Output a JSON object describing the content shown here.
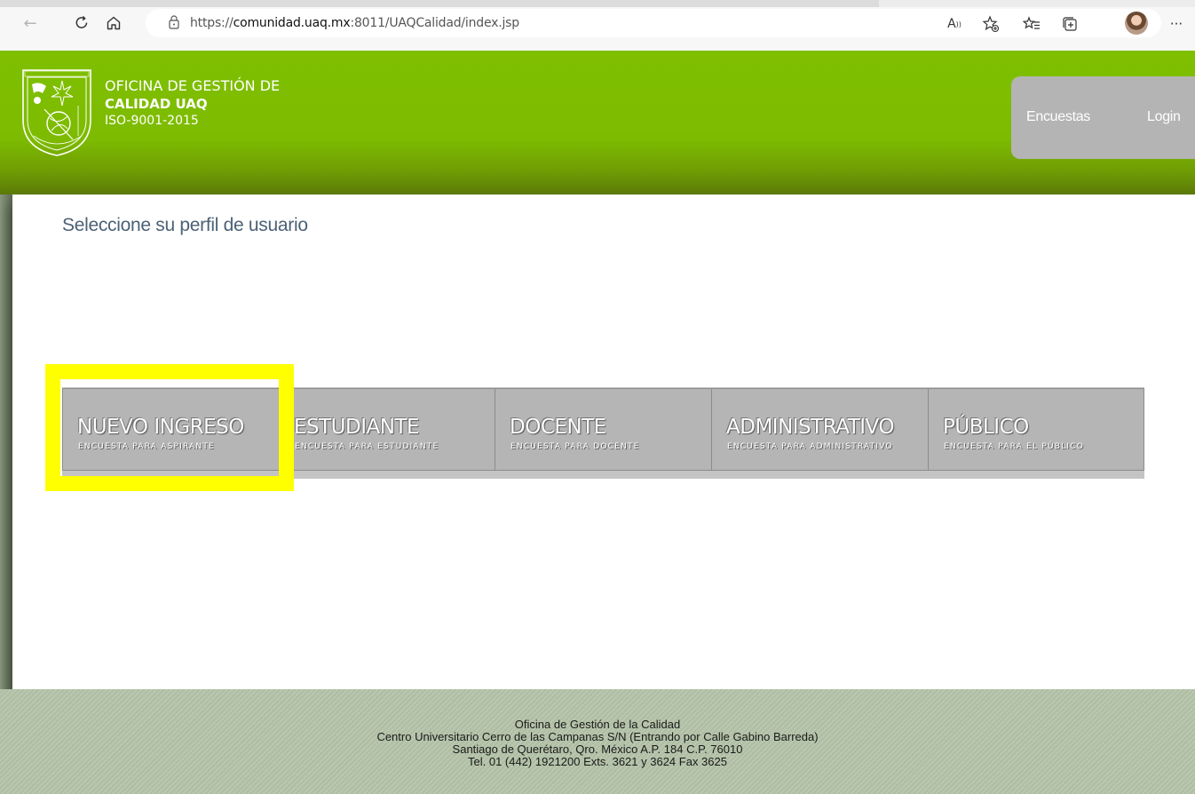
{
  "browser": {
    "url_prefix": "https://",
    "url_domain": "comunidad.uaq.mx",
    "url_path": ":8011/UAQCalidad/index.jsp",
    "icons": [
      "back-icon",
      "refresh-icon",
      "home-icon",
      "lock-icon",
      "read-aloud-icon",
      "add-favorite-icon",
      "favorites-icon",
      "collections-icon",
      "profile-avatar",
      "more-icon"
    ]
  },
  "header": {
    "line1": "OFICINA DE GESTIÓN DE",
    "line2": "CALIDAD UAQ",
    "line3": "ISO-9001-2015",
    "nav": [
      {
        "label": "Encuestas"
      },
      {
        "label": "Login"
      }
    ],
    "colors": {
      "header_green": "#7fbf00",
      "nav_bg": "#b4b4b4"
    }
  },
  "main": {
    "heading": "Seleccione su perfil de usuario",
    "profiles": [
      {
        "title": "NUEVO INGRESO",
        "subtitle": "ENCUESTA PARA ASPIRANTE",
        "highlighted": true
      },
      {
        "title": "ESTUDIANTE",
        "subtitle": "ENCUESTA PARA ESTUDIANTE"
      },
      {
        "title": "DOCENTE",
        "subtitle": "ENCUESTA PARA DOCENTE"
      },
      {
        "title": "ADMINISTRATIVO",
        "subtitle": "ENCUESTA PARA ADMINISTRATIVO"
      },
      {
        "title": "PÚBLICO",
        "subtitle": "ENCUESTA PARA EL PÚBLICO"
      }
    ],
    "colors": {
      "highlight": "#ffff00",
      "tile_bg": "#b5b5b5"
    }
  },
  "footer": {
    "line1": "Oficina de Gestión de la Calidad",
    "line2": "Centro Universitario Cerro de las Campanas S/N (Entrando por Calle Gabino Barreda)",
    "line3": "Santiago de Querétaro, Qro. México A.P. 184 C.P. 76010",
    "line4": "Tel. 01 (442) 1921200 Exts. 3621 y 3624 Fax 3625"
  }
}
